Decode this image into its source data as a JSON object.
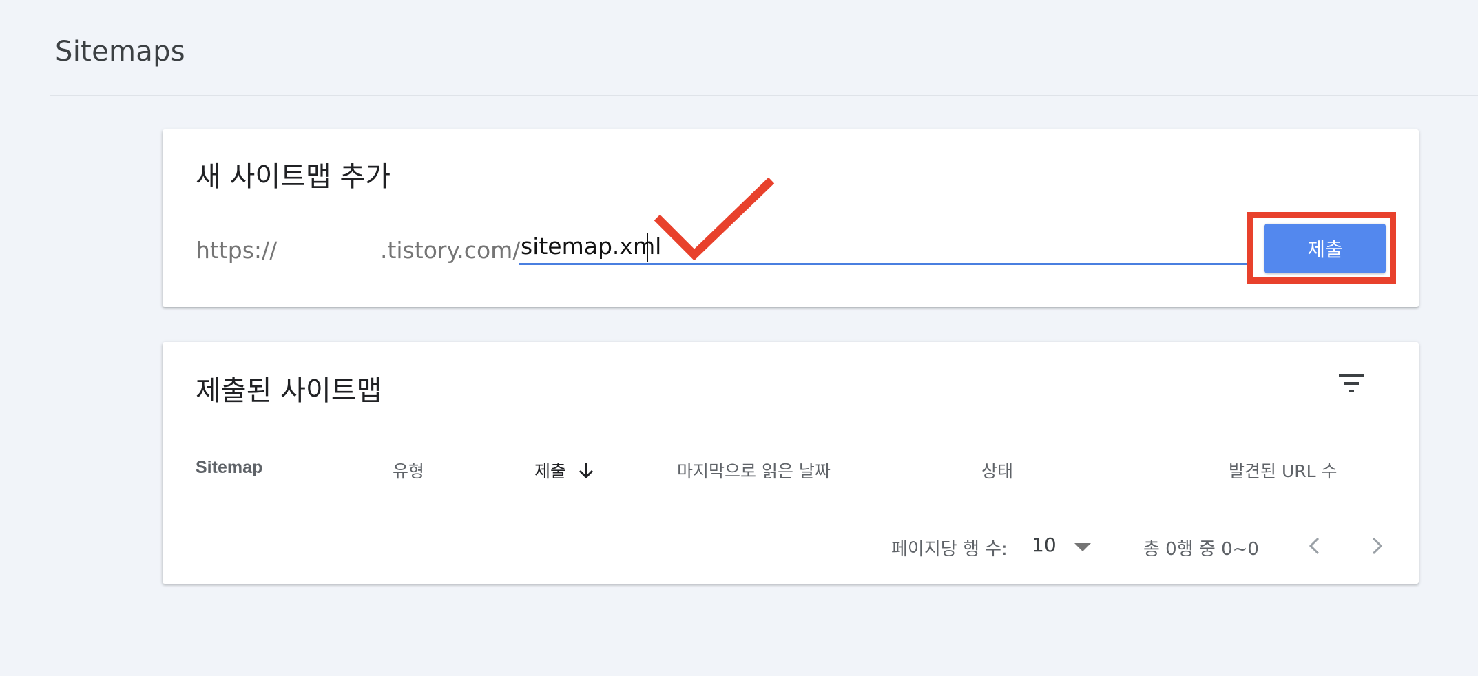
{
  "page": {
    "title": "Sitemaps"
  },
  "add_sitemap": {
    "heading": "새 사이트맵 추가",
    "url_prefix": "https://",
    "url_domain": ".tistory.com/",
    "input_value": "sitemap.xml",
    "submit_label": "제출"
  },
  "submitted_sitemaps": {
    "heading": "제출된 사이트맵",
    "columns": [
      "Sitemap",
      "유형",
      "제출",
      "마지막으로 읽은 날짜",
      "상태",
      "발견된 URL 수"
    ],
    "pagination": {
      "rows_per_page_label": "페이지당 행 수:",
      "rows_per_page_value": "10",
      "range_text": "총 0행 중 0~0"
    }
  },
  "icons": [
    "filter-icon",
    "sort-down-arrow-icon",
    "dropdown-caret-icon",
    "chevron-left-icon",
    "chevron-right-icon",
    "checkmark-annotation-icon"
  ],
  "colors": {
    "accent": "#5388ee",
    "input_underline": "#4a7fe0",
    "annotation_red": "#e8412c",
    "background": "#f1f4f9"
  }
}
